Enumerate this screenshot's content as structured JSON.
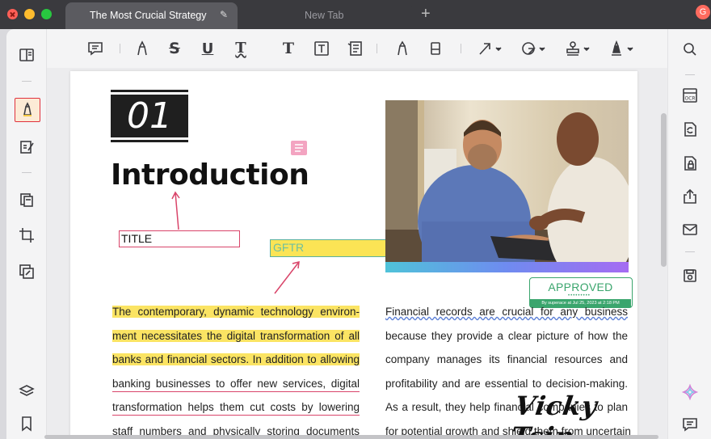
{
  "window": {
    "active_tab_title": "The Most Crucial Strategy",
    "inactive_tab_title": "New Tab",
    "user_initial": "G"
  },
  "toolbar": {
    "tools": [
      "comment-icon",
      "highlight-icon",
      "strikethrough-icon",
      "underline-icon",
      "squiggly-underline-icon",
      "text-icon",
      "textbox-icon",
      "text-callout-icon",
      "pencil-icon",
      "eraser-icon",
      "arrow-line-icon",
      "shape-icon",
      "stamp-icon",
      "signature-icon"
    ]
  },
  "document": {
    "section_number": "01",
    "heading": "Introduction",
    "title_box_text": "TITLE",
    "gftr_box_text": "GFTR",
    "stamp": {
      "label": "APPROVED",
      "dots": "•••••••••",
      "footer": "By superace at Jul 25, 2023 at 2:18 PM"
    },
    "left_column": [
      "The contemporary, dynamic technology environ-",
      "ment necessitates the digital transformation of all",
      "banks and financial sectors. In addition to allowing",
      "banking businesses to offer new services, digital",
      "transformation helps them cut costs by lowering",
      "staff numbers and physically storing documents"
    ],
    "right_column": [
      "Financial records are crucial for any business",
      "because they provide a clear picture of how the",
      "company manages its financial resources and",
      "profitability and are essential to decision-making.",
      "As a result, they help financial companies to plan",
      "for potential growth and shield them from uncertain"
    ],
    "signature": "Vicky Tsin"
  },
  "colors": {
    "highlight": "#fbe463",
    "stamp_green": "#3aa56d",
    "annotation_red": "#d9456a"
  }
}
